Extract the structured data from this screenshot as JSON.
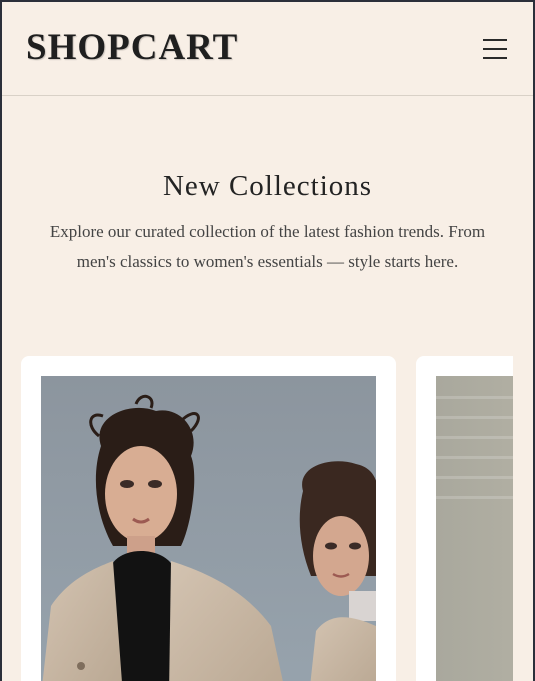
{
  "header": {
    "logo": "SHOPCART",
    "menu_icon": "hamburger-menu-icon"
  },
  "intro": {
    "title": "New Collections",
    "description": "Explore our curated collection of the latest fashion trends. From men's classics to women's essentials — style starts here."
  },
  "carousel": {
    "cards": [
      {
        "image_subject": "two women with curly dark hair in beige trench coats against a blue-grey sky"
      },
      {
        "image_subject": "grey-green textured background with garment edge"
      }
    ]
  },
  "colors": {
    "background": "#f8efe6",
    "card": "#ffffff",
    "text": "#232323",
    "frame": "#2b2f3a"
  }
}
